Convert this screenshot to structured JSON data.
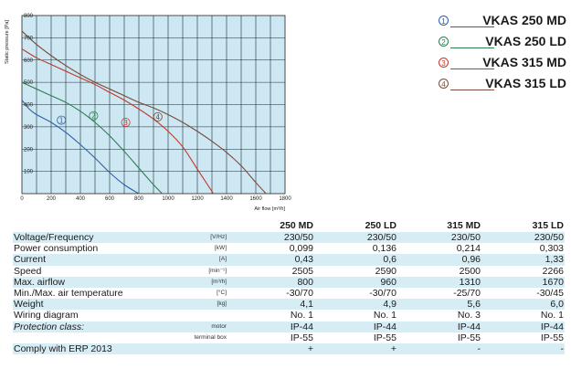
{
  "chart_data": {
    "type": "line",
    "xlabel": "Air flow [m³/h]",
    "ylabel": "Static pressure [Pa]",
    "xlim": [
      0,
      1800
    ],
    "ylim": [
      0,
      800
    ],
    "x_ticks": [
      0,
      200,
      400,
      600,
      800,
      1000,
      1200,
      1400,
      1600,
      1800
    ],
    "y_ticks": [
      100,
      200,
      300,
      400,
      500,
      600,
      700,
      800
    ],
    "grid": true,
    "background": "#cde8f3",
    "series": [
      {
        "name": "VKAS 250 MD",
        "marker": "①",
        "color": "#2f5fa8",
        "x": [
          0,
          50,
          100,
          200,
          300,
          400,
          500,
          600,
          700,
          800
        ],
        "y": [
          420,
          380,
          355,
          320,
          275,
          220,
          160,
          95,
          40,
          0
        ],
        "label_at": [
          270,
          330
        ]
      },
      {
        "name": "VKAS 250 LD",
        "marker": "②",
        "color": "#2e7d4f",
        "x": [
          0,
          100,
          200,
          300,
          400,
          500,
          600,
          700,
          800,
          900,
          960
        ],
        "y": [
          500,
          470,
          440,
          410,
          370,
          320,
          260,
          190,
          115,
          40,
          0
        ],
        "label_at": [
          490,
          350
        ]
      },
      {
        "name": "VKAS 315 MD",
        "marker": "③",
        "color": "#c0392b",
        "x": [
          0,
          100,
          200,
          300,
          400,
          500,
          600,
          700,
          800,
          900,
          1000,
          1100,
          1200,
          1310
        ],
        "y": [
          650,
          610,
          580,
          550,
          520,
          490,
          455,
          420,
          380,
          335,
          280,
          210,
          110,
          0
        ],
        "label_at": [
          710,
          320
        ]
      },
      {
        "name": "VKAS 315 LD",
        "marker": "④",
        "color": "#7a4a3a",
        "x": [
          0,
          100,
          200,
          300,
          400,
          500,
          600,
          700,
          800,
          900,
          1000,
          1100,
          1200,
          1300,
          1400,
          1500,
          1600,
          1670
        ],
        "y": [
          730,
          670,
          620,
          575,
          535,
          500,
          470,
          440,
          410,
          385,
          355,
          320,
          280,
          235,
          185,
          125,
          50,
          0
        ],
        "label_at": [
          930,
          345
        ]
      }
    ]
  },
  "spec_table": {
    "columns": [
      "250 MD",
      "250 LD",
      "315 MD",
      "315 LD"
    ],
    "rows": [
      {
        "label": "Voltage/Frequency",
        "unit": "[V/Hz]",
        "values": [
          "230/50",
          "230/50",
          "230/50",
          "230/50"
        ]
      },
      {
        "label": "Power consumption",
        "unit": "[kW]",
        "values": [
          "0,099",
          "0,136",
          "0,214",
          "0,303"
        ]
      },
      {
        "label": "Current",
        "unit": "[A]",
        "values": [
          "0,43",
          "0,6",
          "0,96",
          "1,33"
        ]
      },
      {
        "label": "Speed",
        "unit": "[min⁻¹]",
        "values": [
          "2505",
          "2590",
          "2500",
          "2266"
        ]
      },
      {
        "label": "Max. airflow",
        "unit": "[m³/h]",
        "values": [
          "800",
          "960",
          "1310",
          "1670"
        ]
      },
      {
        "label": "Min./Max. air temperature",
        "unit": "[°C]",
        "values": [
          "-30/70",
          "-30/70",
          "-25/70",
          "-30/45"
        ]
      },
      {
        "label": "Weight",
        "unit": "[kg]",
        "values": [
          "4,1",
          "4,9",
          "5,6",
          "6,0"
        ]
      },
      {
        "label": "Wiring diagram",
        "unit": "",
        "values": [
          "No. 1",
          "No. 1",
          "No. 3",
          "No. 1"
        ]
      },
      {
        "label": "Protection class:",
        "unit": "motor",
        "italic": true,
        "values": [
          "IP-44",
          "IP-44",
          "IP-44",
          "IP-44"
        ]
      },
      {
        "label": "",
        "unit": "terminal box",
        "values": [
          "IP-55",
          "IP-55",
          "IP-55",
          "IP-55"
        ]
      },
      {
        "label": "Comply with ERP 2013",
        "unit": "",
        "values": [
          "+",
          "+",
          "-",
          "-"
        ]
      }
    ]
  }
}
